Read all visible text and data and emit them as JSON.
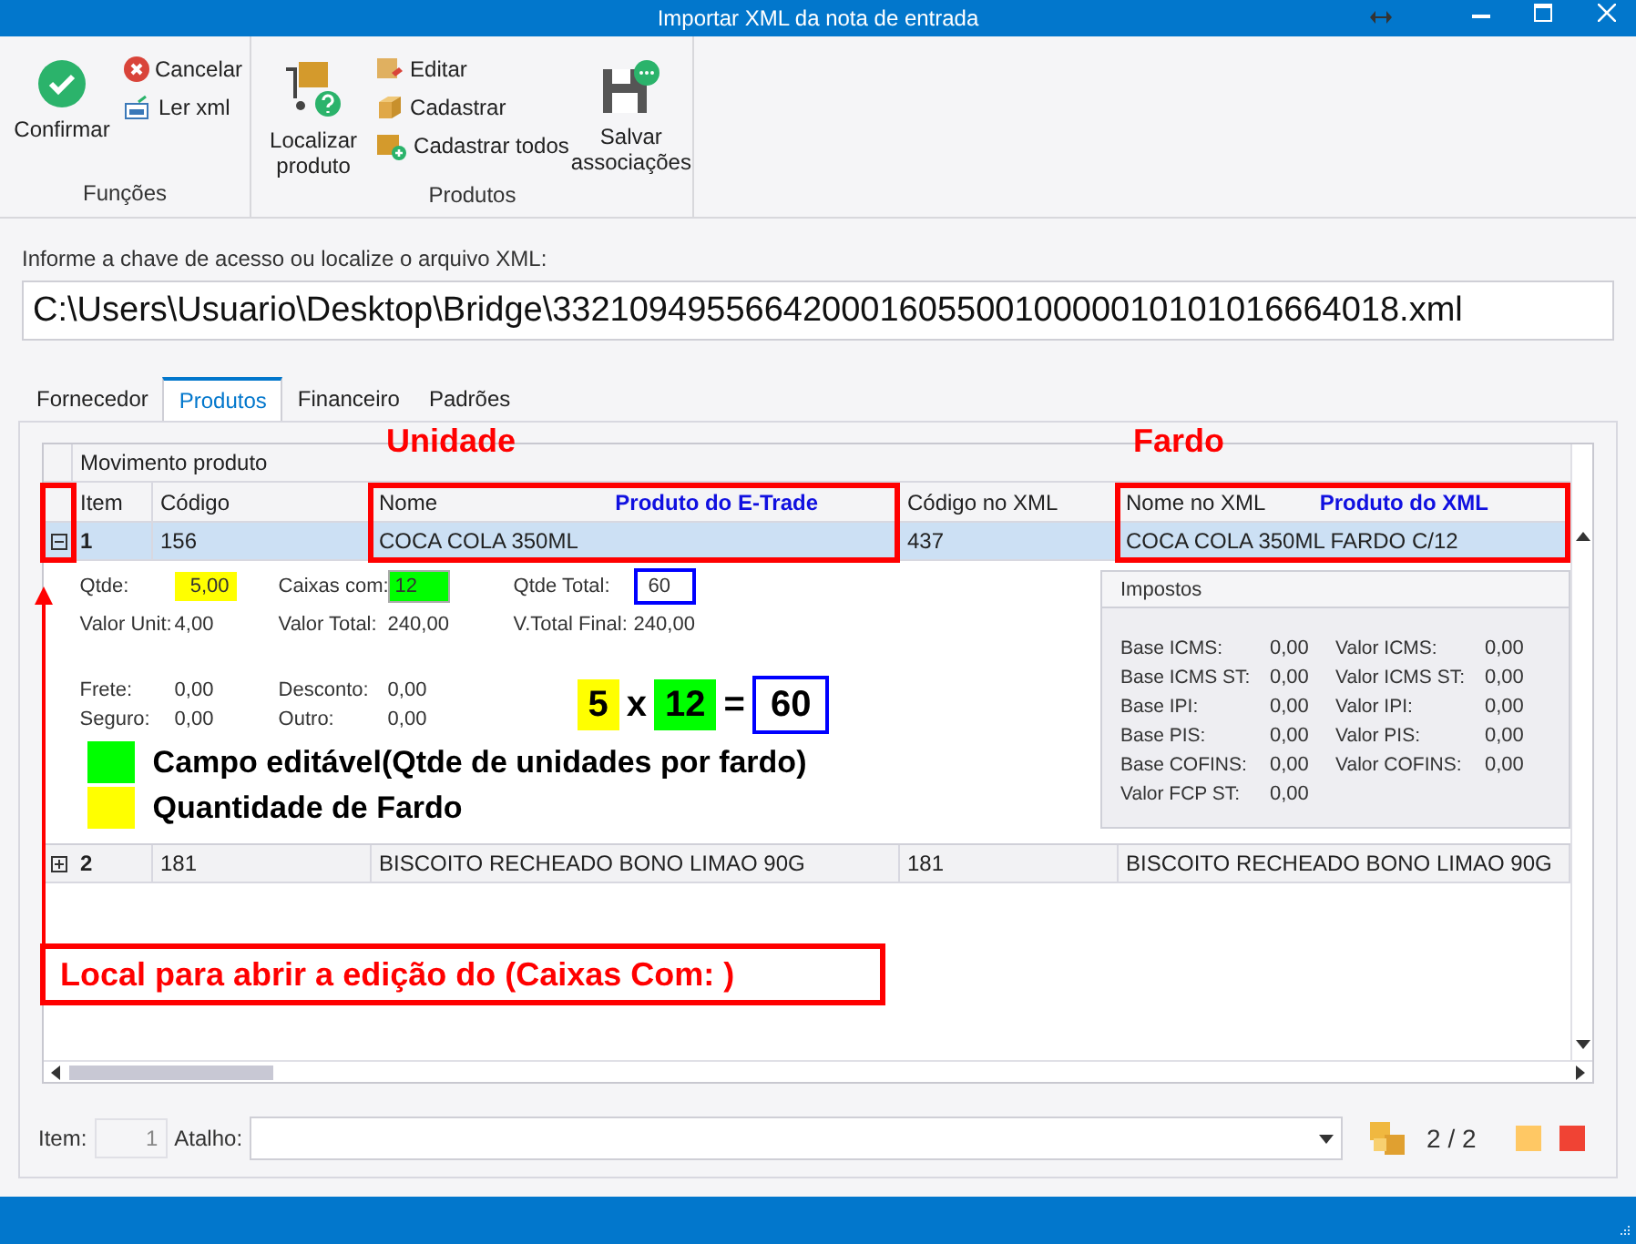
{
  "window": {
    "title": "Importar XML da nota de entrada"
  },
  "ribbon": {
    "groups": [
      {
        "label": "Funções",
        "buttons": [
          {
            "label": "Confirmar",
            "kind": "large"
          },
          {
            "label": "Cancelar",
            "kind": "small"
          },
          {
            "label": "Ler xml",
            "kind": "small"
          }
        ]
      },
      {
        "label": "Produtos",
        "buttons": [
          {
            "label": "Localizar produto",
            "kind": "large"
          },
          {
            "label": "Editar",
            "kind": "small"
          },
          {
            "label": "Cadastrar",
            "kind": "small"
          },
          {
            "label": "Cadastrar todos",
            "kind": "small"
          },
          {
            "label": "Salvar associações",
            "kind": "large"
          }
        ]
      }
    ]
  },
  "file": {
    "label": "Informe a chave de acesso ou localize o arquivo XML:",
    "value": "C:\\Users\\Usuario\\Desktop\\Bridge\\33210949556642000160550010000010101016664018.xml"
  },
  "tabs": [
    {
      "label": "Fornecedor",
      "selected": false
    },
    {
      "label": "Produtos",
      "selected": true
    },
    {
      "label": "Financeiro",
      "selected": false
    },
    {
      "label": "Padrões",
      "selected": false
    }
  ],
  "grid": {
    "group_header": "Movimento produto",
    "expander_marked": true,
    "columns": [
      {
        "label": "Item",
        "boxed": false
      },
      {
        "label": "Código",
        "boxed": false
      },
      {
        "label": "Nome",
        "boxed": true,
        "callout": "Unidade",
        "note": "Produto do E-Trade"
      },
      {
        "label": "Código no XML",
        "boxed": false
      },
      {
        "label": "Nome no XML",
        "boxed": true,
        "callout": "Fardo",
        "note": "Produto do XML"
      }
    ],
    "rows": [
      {
        "cells": [
          "1",
          "156",
          "COCA COLA 350ML",
          "437",
          "COCA COLA 350ML FARDO C/12"
        ],
        "expanded": true,
        "selected": true
      },
      {
        "cells": [
          "2",
          "181",
          "BISCOITO RECHEADO BONO LIMAO 90G",
          "181",
          "BISCOITO RECHEADO BONO LIMAO 90G"
        ],
        "expanded": false,
        "selected": false
      }
    ],
    "detail": {
      "fields": [
        [
          {
            "label": "Qtde:",
            "value": "5,00",
            "kind": "fill",
            "color": "#ffff00"
          },
          {
            "label": "Caixas com:",
            "value": "12",
            "kind": "input",
            "color": "#00ff00"
          },
          {
            "label": "Qtde Total:",
            "value": "60",
            "kind": "outline",
            "color": "#0000ff"
          }
        ],
        [
          {
            "label": "Valor Unit:",
            "value": "4,00",
            "kind": "plain"
          },
          {
            "label": "Valor Total:",
            "value": "240,00",
            "kind": "plain"
          },
          {
            "label": "V.Total Final:",
            "value": "240,00",
            "kind": "plain"
          }
        ],
        [
          {
            "label": "Frete:",
            "value": "0,00",
            "kind": "plain"
          },
          {
            "label": "Desconto:",
            "value": "0,00",
            "kind": "plain"
          }
        ],
        [
          {
            "label": "Seguro:",
            "value": "0,00",
            "kind": "plain"
          },
          {
            "label": "Outro:",
            "value": "0,00",
            "kind": "plain"
          }
        ]
      ],
      "formula": [
        {
          "text": "5",
          "kind": "fill",
          "color": "#ffff00"
        },
        {
          "text": "x",
          "kind": "plain"
        },
        {
          "text": "12",
          "kind": "fill",
          "color": "#00ff00"
        },
        {
          "text": "=",
          "kind": "plain"
        },
        {
          "text": "60",
          "kind": "outline",
          "color": "#0000ff"
        }
      ],
      "legend": [
        {
          "text": "Campo editável(Qtde de unidades por fardo)",
          "color": "#00ff00"
        },
        {
          "text": "Quantidade de Fardo",
          "color": "#ffff00"
        }
      ],
      "taxes": {
        "title": "Impostos",
        "left": [
          {
            "label": "Base ICMS:",
            "value": "0,00"
          },
          {
            "label": "Base ICMS ST:",
            "value": "0,00"
          },
          {
            "label": "Base IPI:",
            "value": "0,00"
          },
          {
            "label": "Base PIS:",
            "value": "0,00"
          },
          {
            "label": "Base COFINS:",
            "value": "0,00"
          },
          {
            "label": "Valor FCP ST:",
            "value": "0,00"
          }
        ],
        "right": [
          {
            "label": "Valor ICMS:",
            "value": "0,00"
          },
          {
            "label": "Valor ICMS ST:",
            "value": "0,00"
          },
          {
            "label": "Valor IPI:",
            "value": "0,00"
          },
          {
            "label": "Valor PIS:",
            "value": "0,00"
          },
          {
            "label": "Valor COFINS:",
            "value": "0,00"
          }
        ]
      }
    },
    "callout": "Local para abrir a edição do (Caixas Com: )"
  },
  "footer": {
    "item_label": "Item:",
    "item_value": "1",
    "shortcut_label": "Atalho:",
    "pager": "2 / 2",
    "swatches": [
      {
        "color": "#ffc864"
      },
      {
        "color": "#f04334"
      }
    ]
  }
}
